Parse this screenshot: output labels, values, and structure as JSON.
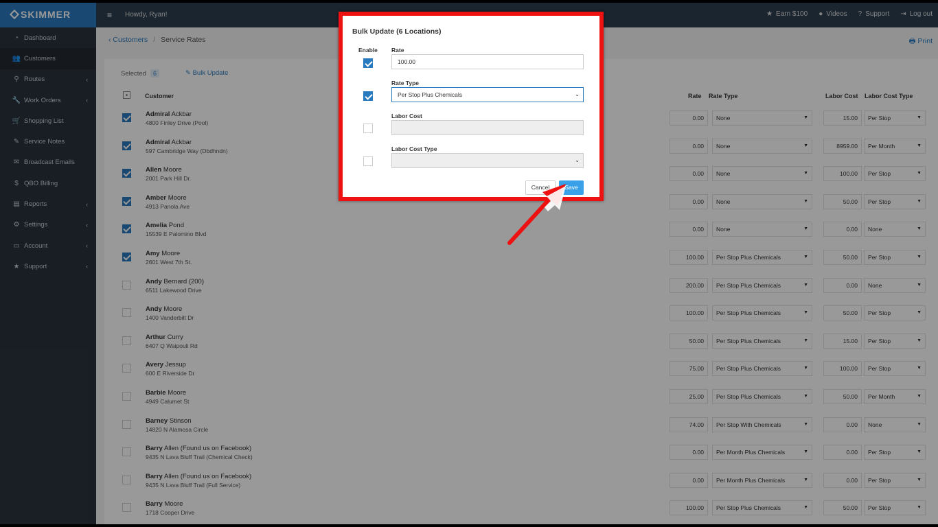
{
  "app": {
    "brand": "SKIMMER",
    "greeting": "Howdy, Ryan!"
  },
  "topnav": [
    {
      "icon": "star-icon",
      "glyph": "★",
      "label": "Earn $100"
    },
    {
      "icon": "play-icon",
      "glyph": "●",
      "label": "Videos"
    },
    {
      "icon": "help-icon",
      "glyph": "?",
      "label": "Support"
    },
    {
      "icon": "logout-icon",
      "glyph": "⇥",
      "label": "Log out"
    }
  ],
  "sidebar": [
    {
      "label": "Dashboard",
      "glyph": "◔",
      "chev": false
    },
    {
      "label": "Customers",
      "glyph": "👥",
      "chev": false
    },
    {
      "label": "Routes",
      "glyph": "⚲",
      "chev": true
    },
    {
      "label": "Work Orders",
      "glyph": "🔧",
      "chev": true
    },
    {
      "label": "Shopping List",
      "glyph": "🛒",
      "chev": false
    },
    {
      "label": "Service Notes",
      "glyph": "✎",
      "chev": false
    },
    {
      "label": "Broadcast Emails",
      "glyph": "✉",
      "chev": false
    },
    {
      "label": "QBO Billing",
      "glyph": "$",
      "chev": false
    },
    {
      "label": "Reports",
      "glyph": "▤",
      "chev": true
    },
    {
      "label": "Settings",
      "glyph": "⚙",
      "chev": true
    },
    {
      "label": "Account",
      "glyph": "▭",
      "chev": true
    },
    {
      "label": "Support",
      "glyph": "★",
      "chev": true
    }
  ],
  "breadcrumb": {
    "back": "‹ Customers",
    "sep": "/",
    "current": "Service Rates"
  },
  "print_label": "🖶 Print",
  "selection": {
    "label": "Selected",
    "count": "6",
    "bulk_label": "✎ Bulk Update"
  },
  "table": {
    "headers": {
      "customer": "Customer",
      "rate": "Rate",
      "rate_type": "Rate Type",
      "labor_cost": "Labor Cost",
      "labor_cost_type": "Labor Cost Type"
    },
    "rows": [
      {
        "checked": true,
        "first": "Admiral",
        "rest": " Ackbar",
        "address": "4800 Finley Drive (Pool)",
        "rate": "0.00",
        "rate_type": "None",
        "labor_cost": "15.00",
        "labor_type": "Per Stop"
      },
      {
        "checked": true,
        "first": "Admiral",
        "rest": " Ackbar",
        "address": "597 Cambridge Way (Dbdhndn)",
        "rate": "0.00",
        "rate_type": "None",
        "labor_cost": "8959.00",
        "labor_type": "Per Month"
      },
      {
        "checked": true,
        "first": "Allen",
        "rest": " Moore",
        "address": "2001 Park Hill Dr.",
        "rate": "0.00",
        "rate_type": "None",
        "labor_cost": "100.00",
        "labor_type": "Per Stop"
      },
      {
        "checked": true,
        "first": "Amber",
        "rest": " Moore",
        "address": "4913 Panola Ave",
        "rate": "0.00",
        "rate_type": "None",
        "labor_cost": "50.00",
        "labor_type": "Per Stop"
      },
      {
        "checked": true,
        "first": "Amelia",
        "rest": " Pond",
        "address": "15539 E Palomino Blvd",
        "rate": "0.00",
        "rate_type": "None",
        "labor_cost": "0.00",
        "labor_type": "None"
      },
      {
        "checked": true,
        "first": "Amy",
        "rest": " Moore",
        "address": "2601 West 7th St.",
        "rate": "100.00",
        "rate_type": "Per Stop Plus Chemicals",
        "labor_cost": "50.00",
        "labor_type": "Per Stop"
      },
      {
        "checked": false,
        "first": "Andy",
        "rest": " Bernard (200)",
        "address": "6511 Lakewood Drive",
        "rate": "200.00",
        "rate_type": "Per Stop Plus Chemicals",
        "labor_cost": "0.00",
        "labor_type": "None"
      },
      {
        "checked": false,
        "first": "Andy",
        "rest": " Moore",
        "address": "1400 Vanderbilt Dr",
        "rate": "100.00",
        "rate_type": "Per Stop Plus Chemicals",
        "labor_cost": "50.00",
        "labor_type": "Per Stop"
      },
      {
        "checked": false,
        "first": "Arthur",
        "rest": " Curry",
        "address": "6407 Q Waipouli Rd",
        "rate": "50.00",
        "rate_type": "Per Stop Plus Chemicals",
        "labor_cost": "15.00",
        "labor_type": "Per Stop"
      },
      {
        "checked": false,
        "first": "Avery",
        "rest": " Jessup",
        "address": "600 E Riverside Dr",
        "rate": "75.00",
        "rate_type": "Per Stop Plus Chemicals",
        "labor_cost": "100.00",
        "labor_type": "Per Stop"
      },
      {
        "checked": false,
        "first": "Barbie",
        "rest": " Moore",
        "address": "4949 Calumet St",
        "rate": "25.00",
        "rate_type": "Per Stop Plus Chemicals",
        "labor_cost": "50.00",
        "labor_type": "Per Month"
      },
      {
        "checked": false,
        "first": "Barney",
        "rest": " Stinson",
        "address": "14820 N Alamosa Circle",
        "rate": "74.00",
        "rate_type": "Per Stop With Chemicals",
        "labor_cost": "0.00",
        "labor_type": "None"
      },
      {
        "checked": false,
        "first": "Barry",
        "rest": " Allen (Found us on Facebook)",
        "address": "9435 N Lava Bluff Trail (Chemical Check)",
        "rate": "0.00",
        "rate_type": "Per Month Plus Chemicals",
        "labor_cost": "0.00",
        "labor_type": "Per Stop"
      },
      {
        "checked": false,
        "first": "Barry",
        "rest": " Allen (Found us on Facebook)",
        "address": "9435 N Lava Bluff Trail (Full Service)",
        "rate": "0.00",
        "rate_type": "Per Month Plus Chemicals",
        "labor_cost": "0.00",
        "labor_type": "Per Stop"
      },
      {
        "checked": false,
        "first": "Barry",
        "rest": " Moore",
        "address": "1718 Cooper Drive",
        "rate": "100.00",
        "rate_type": "Per Stop Plus Chemicals",
        "labor_cost": "50.00",
        "labor_type": "Per Stop"
      }
    ]
  },
  "modal": {
    "title": "Bulk Update (6 Locations)",
    "enable_label": "Enable",
    "rate": {
      "label": "Rate",
      "enabled": true,
      "value": "100.00"
    },
    "rate_type": {
      "label": "Rate Type",
      "enabled": true,
      "value": "Per Stop Plus Chemicals"
    },
    "labor_cost": {
      "label": "Labor Cost",
      "enabled": false,
      "value": ""
    },
    "labor_cost_type": {
      "label": "Labor Cost Type",
      "enabled": false,
      "value": ""
    },
    "cancel_label": "Cancel",
    "save_label": "Save"
  },
  "colors": {
    "accent": "#2a7abf",
    "highlight": "#ee1111",
    "save": "#3aa0e8",
    "sidebar": "#2b333e"
  }
}
